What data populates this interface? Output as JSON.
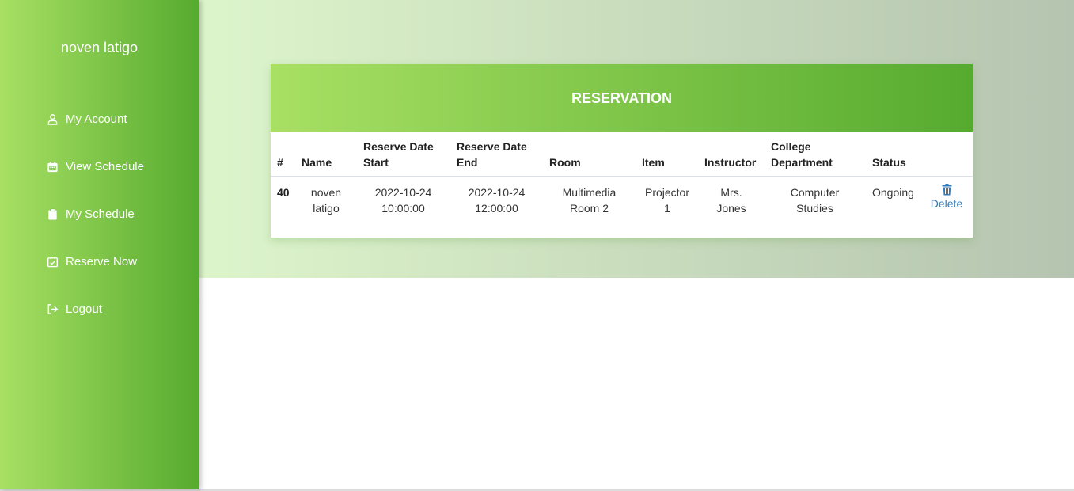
{
  "sidebar": {
    "user_name": "noven latigo",
    "items": [
      {
        "label": "My Account",
        "icon": "user-icon"
      },
      {
        "label": "View Schedule",
        "icon": "calendar-icon"
      },
      {
        "label": "My Schedule",
        "icon": "clipboard-icon"
      },
      {
        "label": "Reserve Now",
        "icon": "calendar-check-icon"
      },
      {
        "label": "Logout",
        "icon": "logout-icon"
      }
    ]
  },
  "card": {
    "title": "RESERVATION",
    "headers": {
      "num": "#",
      "name": "Name",
      "start_1": "Reserve Date",
      "start_2": "Start",
      "end_1": "Reserve Date",
      "end_2": "End",
      "room": "Room",
      "item": "Item",
      "instructor": "Instructor",
      "dept_1": "College",
      "dept_2": "Department",
      "status": "Status"
    },
    "rows": [
      {
        "id": "40",
        "name_1": "noven",
        "name_2": "latigo",
        "start_date": "2022-10-24",
        "start_time": "10:00:00",
        "end_date": "2022-10-24",
        "end_time": "12:00:00",
        "room_1": "Multimedia",
        "room_2": "Room 2",
        "item_1": "Projector",
        "item_2": "1",
        "instructor_1": "Mrs.",
        "instructor_2": "Jones",
        "dept_1": "Computer",
        "dept_2": "Studies",
        "status": "Ongoing",
        "action": "Delete"
      }
    ]
  },
  "colors": {
    "sidebar_gradient_start": "#a8e063",
    "sidebar_gradient_end": "#56ab2f",
    "link": "#337ab7"
  }
}
